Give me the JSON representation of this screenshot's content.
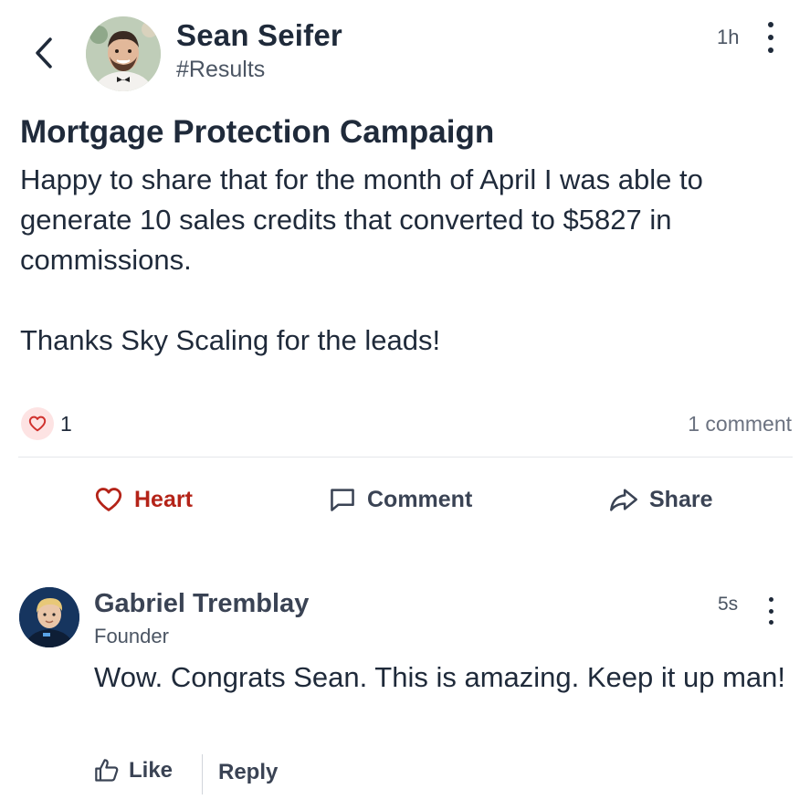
{
  "post": {
    "author_name": "Sean Seifer",
    "channel": "#Results",
    "time": "1h",
    "title": "Mortgage Protection Campaign",
    "body": "Happy to share that for the month of April I was able to generate 10 sales credits that converted to $5827 in commissions.\n\nThanks Sky Scaling for the leads!",
    "reaction_count": "1",
    "comment_count": "1 comment"
  },
  "actions": {
    "heart_label": "Heart",
    "comment_label": "Comment",
    "share_label": "Share"
  },
  "comment": {
    "author_name": "Gabriel Tremblay",
    "role": "Founder",
    "time": "5s",
    "text": "Wow. Congrats Sean. This is amazing. Keep it up man!",
    "like_label": "Like",
    "reply_label": "Reply"
  },
  "icons": {
    "back": "chevron-left-icon",
    "more": "more-vertical-icon",
    "reaction": "heart-icon",
    "comment": "speech-bubble-icon",
    "share": "share-arrow-icon",
    "like": "thumbs-up-icon"
  },
  "colors": {
    "text": "#1f2a3a",
    "heart_active": "#b42318",
    "reaction_badge_bg": "#fde3e3",
    "muted": "#6b7280"
  }
}
